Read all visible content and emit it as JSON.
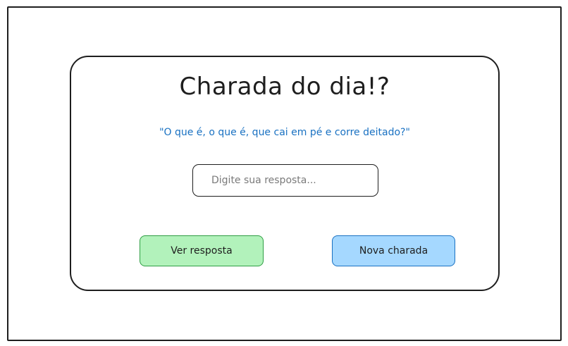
{
  "card": {
    "title": "Charada do dia!?",
    "riddle": "\"O que é, o que é, que cai em pé e corre deitado?\""
  },
  "answer": {
    "placeholder": "Digite sua resposta...",
    "value": ""
  },
  "buttons": {
    "show_answer": "Ver resposta",
    "new_riddle": "Nova charada"
  },
  "colors": {
    "riddle_text": "#1971c2",
    "show_button_fill": "#b2f2bb",
    "show_button_border": "#2f9e44",
    "new_button_fill": "#a5d8ff",
    "new_button_border": "#1971c2",
    "stroke": "#1e1e1e"
  }
}
